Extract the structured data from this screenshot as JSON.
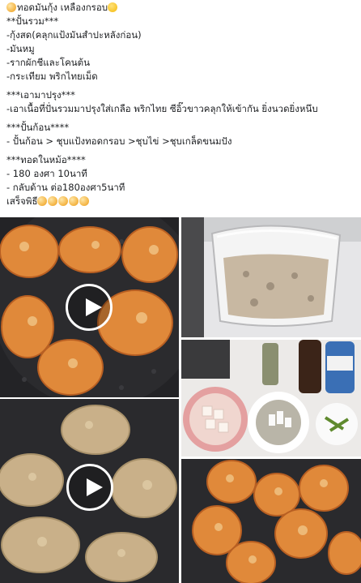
{
  "post": {
    "lines": [
      "ทอดมันกุ้ง เหลืองกรอบ",
      "**ปั้นรวม***",
      "-กุ้งสด(คลุกแป้งมันสำปะหลังก่อน)",
      "-มันหมู",
      "-รากผักชีและโคนต้น",
      "-กระเทียม พริกไทยเม็ด",
      "***เอามาปรุง***",
      "-เอาเนื้อที่ปั่นรวมมาปรุงใส่เกลือ พริกไทย ซีอิ๊วขาวคลุกให้เข้ากัน ยิ่งนวดยิ่งหนึบ",
      "***ปั้นก้อน****",
      "- ปั้นก้อน > ชุบแป้งทอดกรอบ >ชุบไข่ >ชุบเกล็ดขนมปัง",
      "***ทอดในหม้อ****",
      "- 180 องศา 10นาที",
      "- กลับด้าน ต่อ180องศา5นาที",
      "เสร็จพิธี"
    ]
  },
  "media": {
    "tiles": [
      {
        "name": "video-fried-shrimp-cakes",
        "is_video": true
      },
      {
        "name": "photo-blended-shrimp-mix",
        "is_video": false
      },
      {
        "name": "video-breaded-cakes-raw",
        "is_video": true
      },
      {
        "name": "photo-ingredients-bowls",
        "is_video": false
      },
      {
        "name": "photo-fried-cakes-basket",
        "is_video": false
      }
    ]
  },
  "colors": {
    "air_fryer_basket": "#2b2b2e",
    "fried_cake": "#e0893a",
    "raw_cake": "#c9b089"
  }
}
